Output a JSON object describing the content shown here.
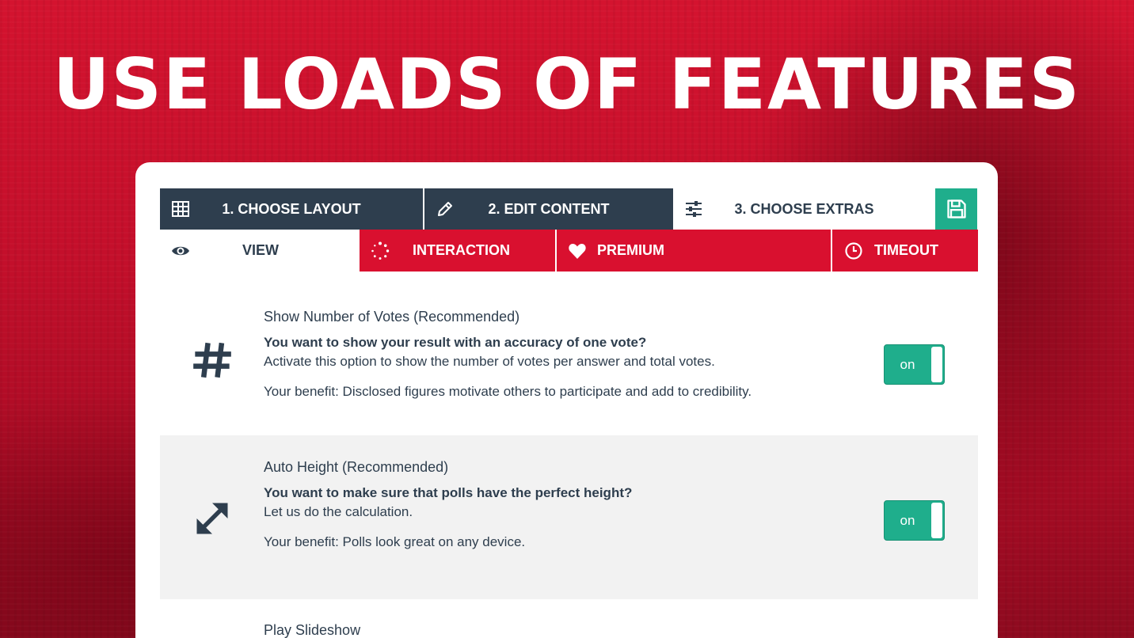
{
  "headline": "USE LOADS OF FEATURES",
  "colors": {
    "accent_red": "#d9102f",
    "dark": "#2e3e4e",
    "green": "#1fae8c"
  },
  "steps": [
    {
      "label": "1. CHOOSE LAYOUT",
      "icon": "table-icon"
    },
    {
      "label": "2. EDIT CONTENT",
      "icon": "pencil-icon"
    },
    {
      "label": "3. CHOOSE EXTRAS",
      "icon": "sliders-icon"
    }
  ],
  "save_icon": "save-icon",
  "subtabs": [
    {
      "label": "VIEW",
      "icon": "eye-icon",
      "active": true
    },
    {
      "label": "INTERACTION",
      "icon": "spinner-icon",
      "active": false
    },
    {
      "label": "PREMIUM",
      "icon": "heart-icon",
      "active": false
    },
    {
      "label": "TIMEOUT",
      "icon": "clock-icon",
      "active": false
    }
  ],
  "options": [
    {
      "title": "Show Number of Votes (Recommended)",
      "question": "You want to show your result with an accuracy of one vote?",
      "description": "Activate this option to show the number of votes per answer and total votes.",
      "benefit": "Your benefit: Disclosed figures motivate others to participate and add to credibility.",
      "toggle": "on",
      "icon": "hash-icon"
    },
    {
      "title": "Auto Height (Recommended)",
      "question": "You want to make sure that polls have the perfect height?",
      "description": "Let us do the calculation.",
      "benefit": "Your benefit: Polls look great on any device.",
      "toggle": "on",
      "icon": "resize-arrows-icon"
    },
    {
      "title": "Play Slideshow"
    }
  ]
}
